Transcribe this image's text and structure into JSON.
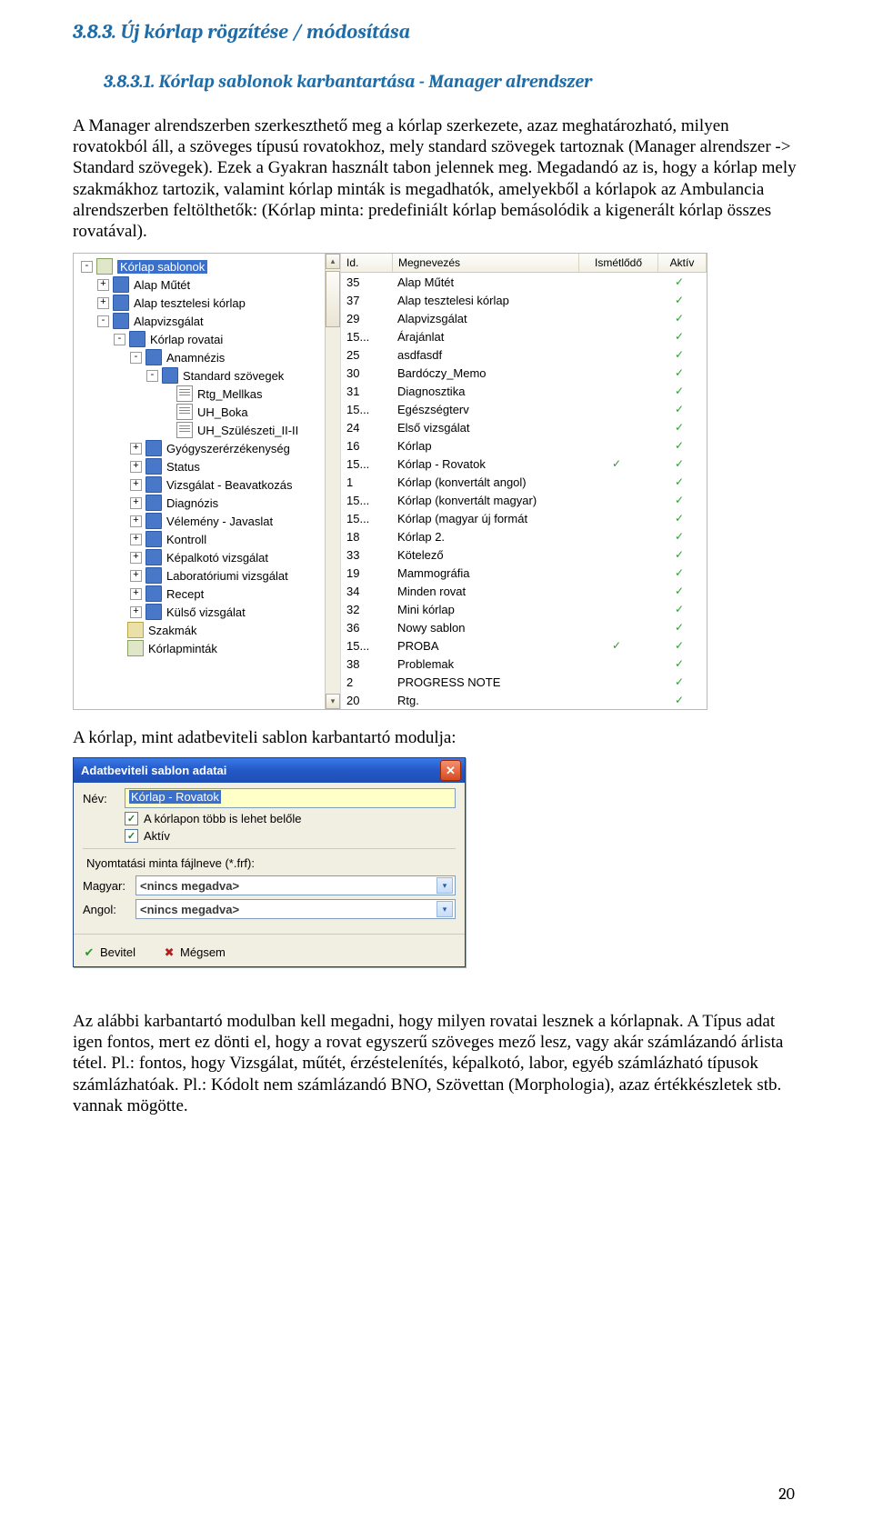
{
  "headings": {
    "section": "3.8.3.  Új kórlap rögzítése / módosítása",
    "sub": "3.8.3.1.  Kórlap sablonok karbantartása - Manager alrendszer"
  },
  "paragraphs": {
    "p1": "A Manager alrendszerben szerkeszthető meg a kórlap szerkezete, azaz meghatározható, milyen rovatokból áll, a szöveges típusú rovatokhoz, mely standard szövegek tartoznak (Manager alrendszer -> Standard szövegek). Ezek a Gyakran használt tabon jelennek meg. Megadandó az is, hogy a kórlap mely szakmákhoz tartozik, valamint kórlap minták is megadhatók, amelyekből a kórlapok az Ambulancia alrendszerben feltölthetők: (Kórlap minta: predefiniált kórlap bemásolódik a kigenerált kórlap összes rovatával).",
    "p2": "A kórlap, mint adatbeviteli sablon karbantartó modulja:",
    "p3": "Az alábbi karbantartó modulban kell megadni, hogy milyen rovatai lesznek a kórlapnak. A Típus adat igen fontos, mert ez dönti el, hogy a rovat egyszerű szöveges mező lesz, vagy akár számlázandó árlista tétel. Pl.: fontos, hogy Vizsgálat, műtét, érzéstelenítés, képalkotó, labor, egyéb számlázható típusok számlázhatóak. Pl.: Kódolt nem számlázandó BNO, Szövettan (Morphologia), azaz értékkészletek stb. vannak mögötte."
  },
  "shot1": {
    "tree": [
      {
        "level": 0,
        "exp": "-",
        "icon": "box",
        "label": "Kórlap sablonok",
        "selected": true
      },
      {
        "level": 1,
        "exp": "+",
        "icon": "folder",
        "label": "Alap Műtét"
      },
      {
        "level": 1,
        "exp": "+",
        "icon": "folder",
        "label": "Alap tesztelesi kórlap"
      },
      {
        "level": 1,
        "exp": "-",
        "icon": "folder",
        "label": "Alapvizsgálat"
      },
      {
        "level": 2,
        "exp": "-",
        "icon": "folder",
        "label": "Kórlap rovatai"
      },
      {
        "level": 3,
        "exp": "-",
        "icon": "folder",
        "label": "Anamnézis"
      },
      {
        "level": 4,
        "exp": "-",
        "icon": "folder",
        "label": "Standard szövegek"
      },
      {
        "level": 5,
        "exp": " ",
        "icon": "doc",
        "label": "Rtg_Mellkas"
      },
      {
        "level": 5,
        "exp": " ",
        "icon": "doc",
        "label": "UH_Boka"
      },
      {
        "level": 5,
        "exp": " ",
        "icon": "doc",
        "label": "UH_Szülészeti_II-II"
      },
      {
        "level": 3,
        "exp": "+",
        "icon": "folder",
        "label": "Gyógyszerérzékenység"
      },
      {
        "level": 3,
        "exp": "+",
        "icon": "folder",
        "label": "Status"
      },
      {
        "level": 3,
        "exp": "+",
        "icon": "folder",
        "label": "Vizsgálat - Beavatkozás"
      },
      {
        "level": 3,
        "exp": "+",
        "icon": "folder",
        "label": "Diagnózis"
      },
      {
        "level": 3,
        "exp": "+",
        "icon": "folder",
        "label": "Vélemény - Javaslat"
      },
      {
        "level": 3,
        "exp": "+",
        "icon": "folder",
        "label": "Kontroll"
      },
      {
        "level": 3,
        "exp": "+",
        "icon": "folder",
        "label": "Képalkotó vizsgálat"
      },
      {
        "level": 3,
        "exp": "+",
        "icon": "folder",
        "label": "Laboratóriumi vizsgálat"
      },
      {
        "level": 3,
        "exp": "+",
        "icon": "folder",
        "label": "Recept"
      },
      {
        "level": 3,
        "exp": "+",
        "icon": "folder",
        "label": "Külső vizsgálat"
      },
      {
        "level": 2,
        "exp": " ",
        "icon": "box2",
        "label": "Szakmák"
      },
      {
        "level": 2,
        "exp": " ",
        "icon": "box",
        "label": "Kórlapminták"
      }
    ],
    "cols": {
      "id": "Id.",
      "name": "Megnevezés",
      "rep": "Ismétlődő",
      "act": "Aktív"
    },
    "rows": [
      {
        "id": "35",
        "name": "Alap Műtét",
        "rep": false,
        "act": true
      },
      {
        "id": "37",
        "name": "Alap tesztelesi kórlap",
        "rep": false,
        "act": true
      },
      {
        "id": "29",
        "name": "Alapvizsgálat",
        "rep": false,
        "act": true
      },
      {
        "id": "15...",
        "name": "Árajánlat",
        "rep": false,
        "act": true
      },
      {
        "id": "25",
        "name": "asdfasdf",
        "rep": false,
        "act": true
      },
      {
        "id": "30",
        "name": "Bardóczy_Memo",
        "rep": false,
        "act": true
      },
      {
        "id": "31",
        "name": "Diagnosztika",
        "rep": false,
        "act": true
      },
      {
        "id": "15...",
        "name": "Egészségterv",
        "rep": false,
        "act": true
      },
      {
        "id": "24",
        "name": "Első vizsgálat",
        "rep": false,
        "act": true
      },
      {
        "id": "16",
        "name": "Kórlap",
        "rep": false,
        "act": true
      },
      {
        "id": "15...",
        "name": "Kórlap - Rovatok",
        "rep": true,
        "act": true
      },
      {
        "id": "1",
        "name": "Kórlap (konvertált angol)",
        "rep": false,
        "act": true
      },
      {
        "id": "15...",
        "name": "Kórlap (konvertált magyar)",
        "rep": false,
        "act": true
      },
      {
        "id": "15...",
        "name": "Kórlap (magyar új formát",
        "rep": false,
        "act": true
      },
      {
        "id": "18",
        "name": "Kórlap 2.",
        "rep": false,
        "act": true
      },
      {
        "id": "33",
        "name": "Kötelező",
        "rep": false,
        "act": true
      },
      {
        "id": "19",
        "name": "Mammográfia",
        "rep": false,
        "act": true
      },
      {
        "id": "34",
        "name": "Minden rovat",
        "rep": false,
        "act": true
      },
      {
        "id": "32",
        "name": "Mini kórlap",
        "rep": false,
        "act": true
      },
      {
        "id": "36",
        "name": "Nowy sablon",
        "rep": false,
        "act": true
      },
      {
        "id": "15...",
        "name": "PROBA",
        "rep": true,
        "act": true
      },
      {
        "id": "38",
        "name": "Problemak",
        "rep": false,
        "act": true
      },
      {
        "id": "2",
        "name": "PROGRESS NOTE",
        "rep": false,
        "act": true
      },
      {
        "id": "20",
        "name": "Rtg.",
        "rep": false,
        "act": true
      }
    ]
  },
  "shot2": {
    "title": "Adatbeviteli sablon adatai",
    "labels": {
      "name": "Név:",
      "chk_multi": "A kórlapon több is lehet belőle",
      "chk_active": "Aktív",
      "print_group": "Nyomtatási minta fájlneve (*.frf):",
      "magyar": "Magyar:",
      "angol": "Angol:",
      "ok": "Bevitel",
      "cancel": "Mégsem"
    },
    "values": {
      "name": "Kórlap - Rovatok",
      "magyar": "<nincs megadva>",
      "angol": "<nincs megadva>",
      "chk_multi": true,
      "chk_active": true
    }
  },
  "page_number": "20"
}
